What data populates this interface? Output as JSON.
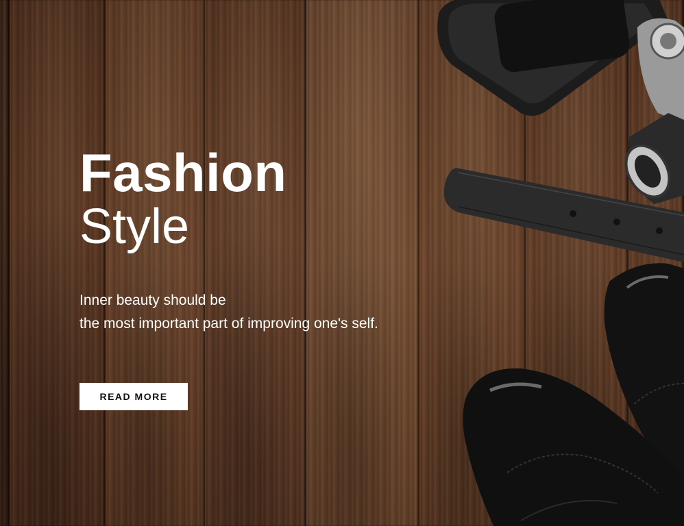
{
  "hero": {
    "title_line1": "Fashion",
    "title_line2": "Style",
    "subtitle_line1": "Inner beauty should be",
    "subtitle_line2": "the most important part of improving one's self.",
    "button_label": "READ MORE"
  },
  "colors": {
    "text": "#ffffff",
    "button_bg": "#ffffff",
    "button_text": "#111111",
    "wood": "#6b412a"
  },
  "icons": [
    "camera-icon",
    "belt-icon",
    "shoe-icon"
  ]
}
